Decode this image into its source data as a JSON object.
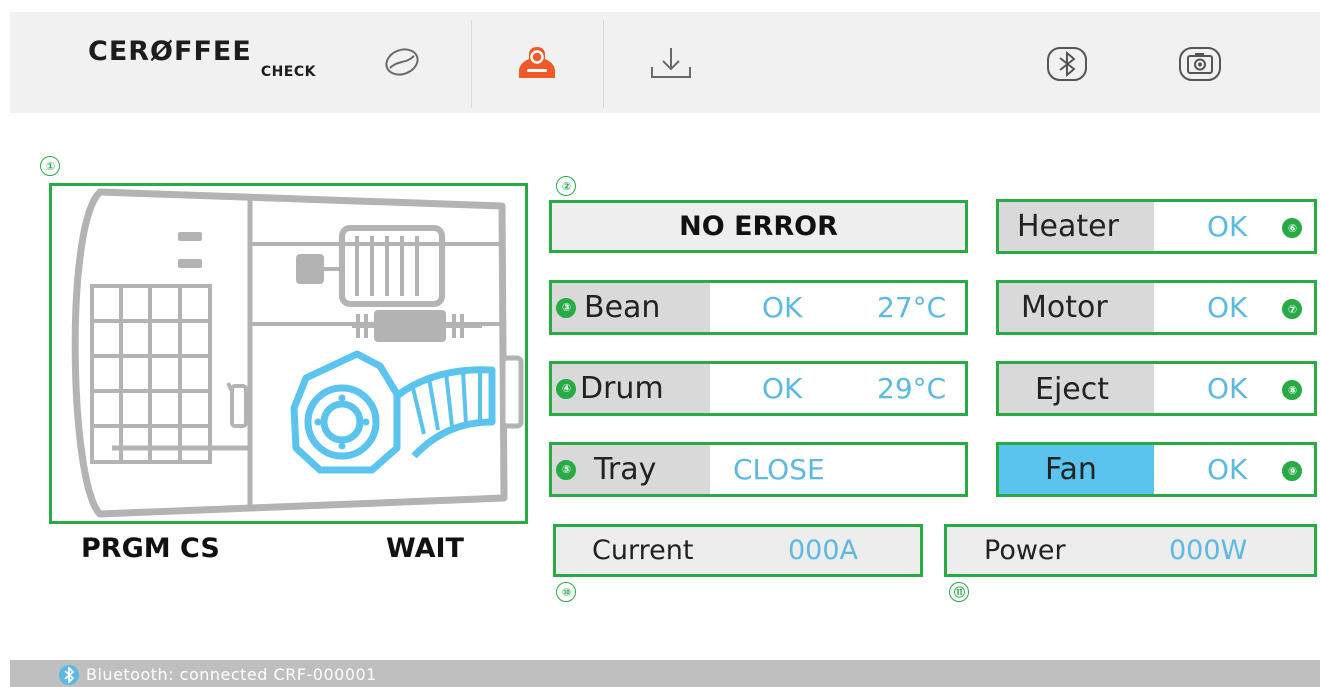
{
  "app": {
    "logo_main": "CERØFFEE",
    "logo_sub": "CHECK"
  },
  "toolbar": {
    "icons": [
      "bean-icon",
      "roaster-icon",
      "download-icon",
      "bluetooth-icon",
      "camera-icon"
    ],
    "active_icon": "roaster-icon",
    "accent_color": "#f05a28"
  },
  "markers": [
    "①",
    "②",
    "③",
    "④",
    "⑤",
    "⑥",
    "⑦",
    "⑧",
    "⑨",
    "⑩",
    "⑪"
  ],
  "diagram": {
    "program": "PRGM CS",
    "state": "WAIT",
    "highlight_color": "#5bc4ee"
  },
  "error": {
    "text": "NO ERROR"
  },
  "sensors": {
    "bean": {
      "label": "Bean",
      "status": "OK",
      "temp": "27°C"
    },
    "drum": {
      "label": "Drum",
      "status": "OK",
      "temp": "29°C"
    },
    "tray": {
      "label": "Tray",
      "status": "CLOSE"
    }
  },
  "components": {
    "heater": {
      "label": "Heater",
      "status": "OK"
    },
    "motor": {
      "label": "Motor",
      "status": "OK"
    },
    "eject": {
      "label": "Eject",
      "status": "OK"
    },
    "fan": {
      "label": "Fan",
      "status": "OK",
      "active": true
    }
  },
  "readings": {
    "current": {
      "label": "Current",
      "value": "000A"
    },
    "power": {
      "label": "Power",
      "value": "000W"
    }
  },
  "statusbar": {
    "text": "Bluetooth: connected  CRF-000001"
  },
  "colors": {
    "frame_green": "#27ab45",
    "value_blue": "#5bb9e2",
    "label_gray": "#d9d9d9",
    "fan_active": "#5bc4ee"
  }
}
